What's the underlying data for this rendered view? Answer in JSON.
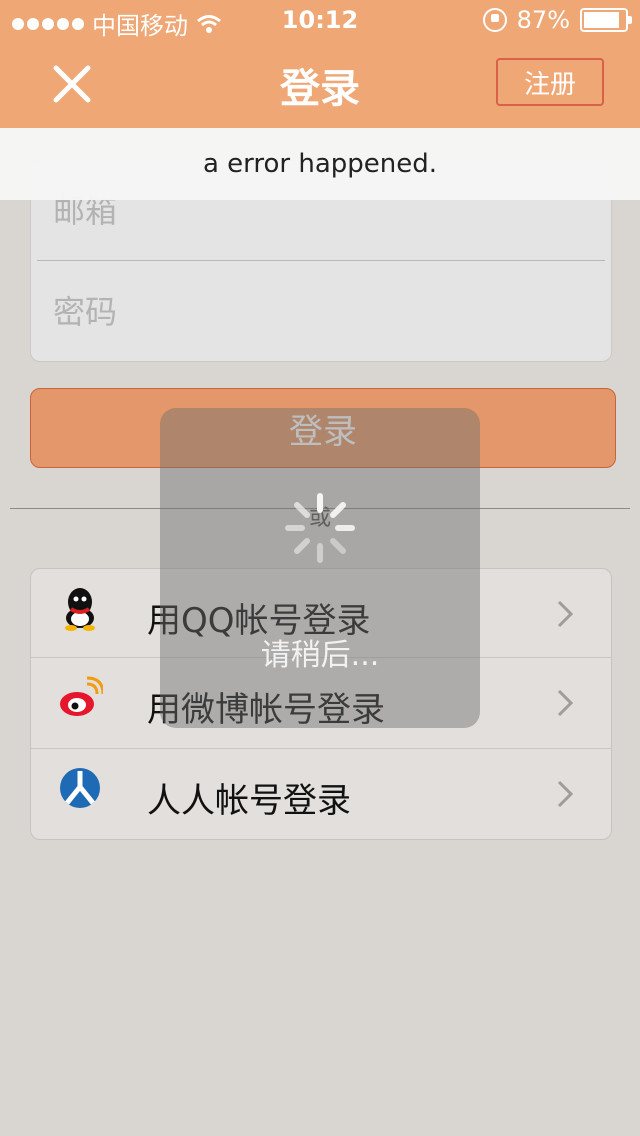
{
  "status_bar": {
    "carrier": "中国移动",
    "time": "10:12",
    "battery": "87%"
  },
  "nav": {
    "title": "登录",
    "register_label": "注册"
  },
  "form": {
    "email_placeholder": "邮箱",
    "password_placeholder": "密码"
  },
  "login_button": "登录",
  "divider_text": "或",
  "social": [
    {
      "label": "用QQ帐号登录",
      "icon": "qq-icon"
    },
    {
      "label": "用微博帐号登录",
      "icon": "weibo-icon"
    },
    {
      "label": "人人帐号登录",
      "icon": "renren-icon"
    }
  ],
  "toast": "a error happened.",
  "loading": "请稍后...",
  "colors": {
    "header": "#eea775",
    "register_border": "#d9604a",
    "login_button": "#e3976a",
    "background": "#d9d5d1"
  }
}
